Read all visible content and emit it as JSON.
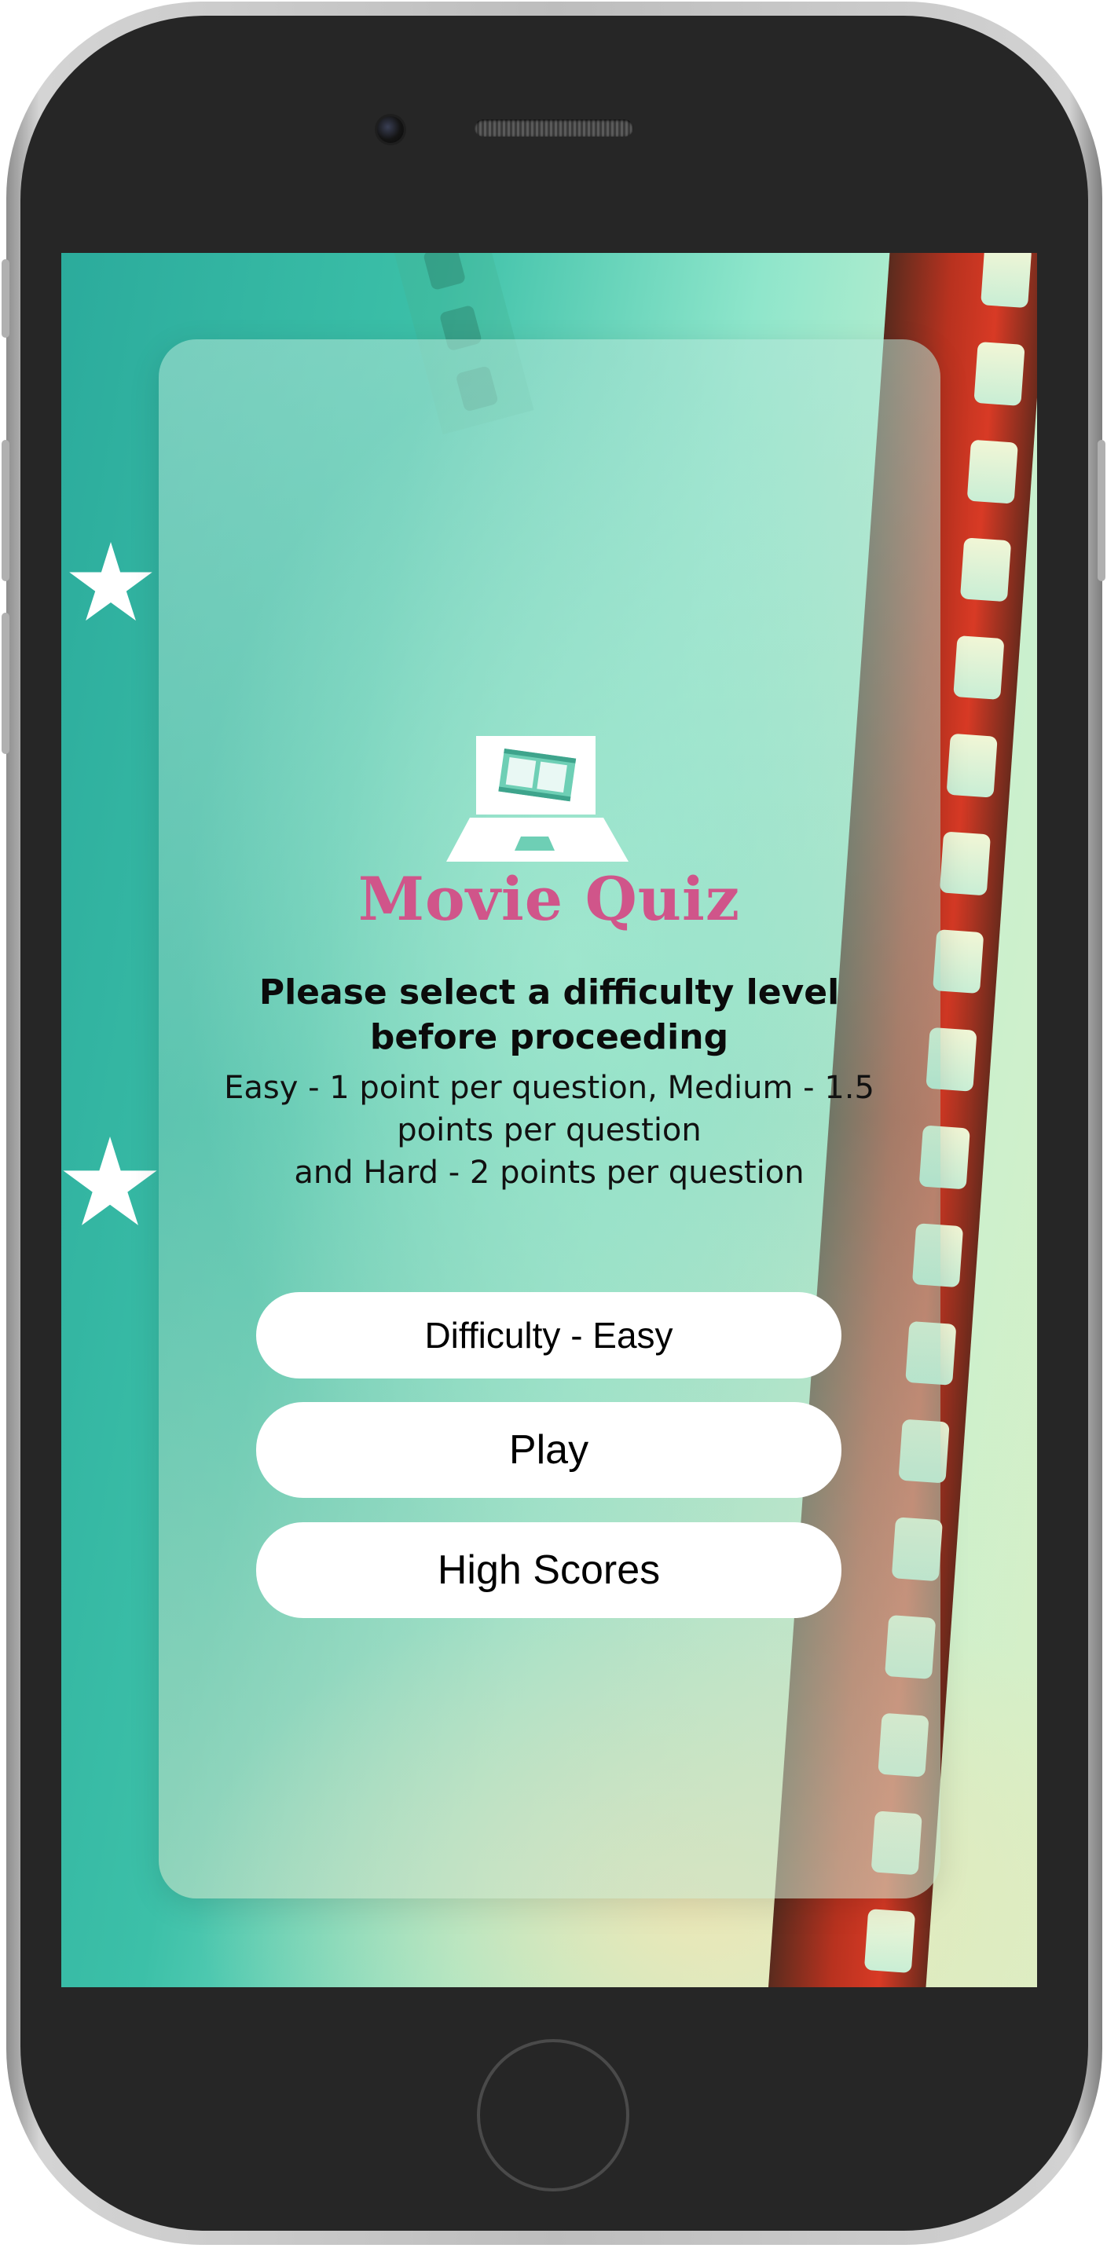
{
  "app": {
    "title": "Movie Quiz",
    "heading": "Please select a difficulty level before proceeding",
    "description": [
      "Easy - 1 point per question, Medium - 1.5",
      "points per question",
      "and Hard - 2 points per question"
    ]
  },
  "buttons": {
    "difficulty_label": "Difficulty - Easy",
    "play_label": "Play",
    "high_scores_label": "High Scores"
  },
  "colors": {
    "accent_title": "#d0558a",
    "background": "#3cc0a8",
    "button_bg": "#ffffff",
    "filmstrip": "#d83a25"
  },
  "icons": [
    "laptop-film-logo-icon",
    "star-icon",
    "filmstrip-decoration"
  ]
}
